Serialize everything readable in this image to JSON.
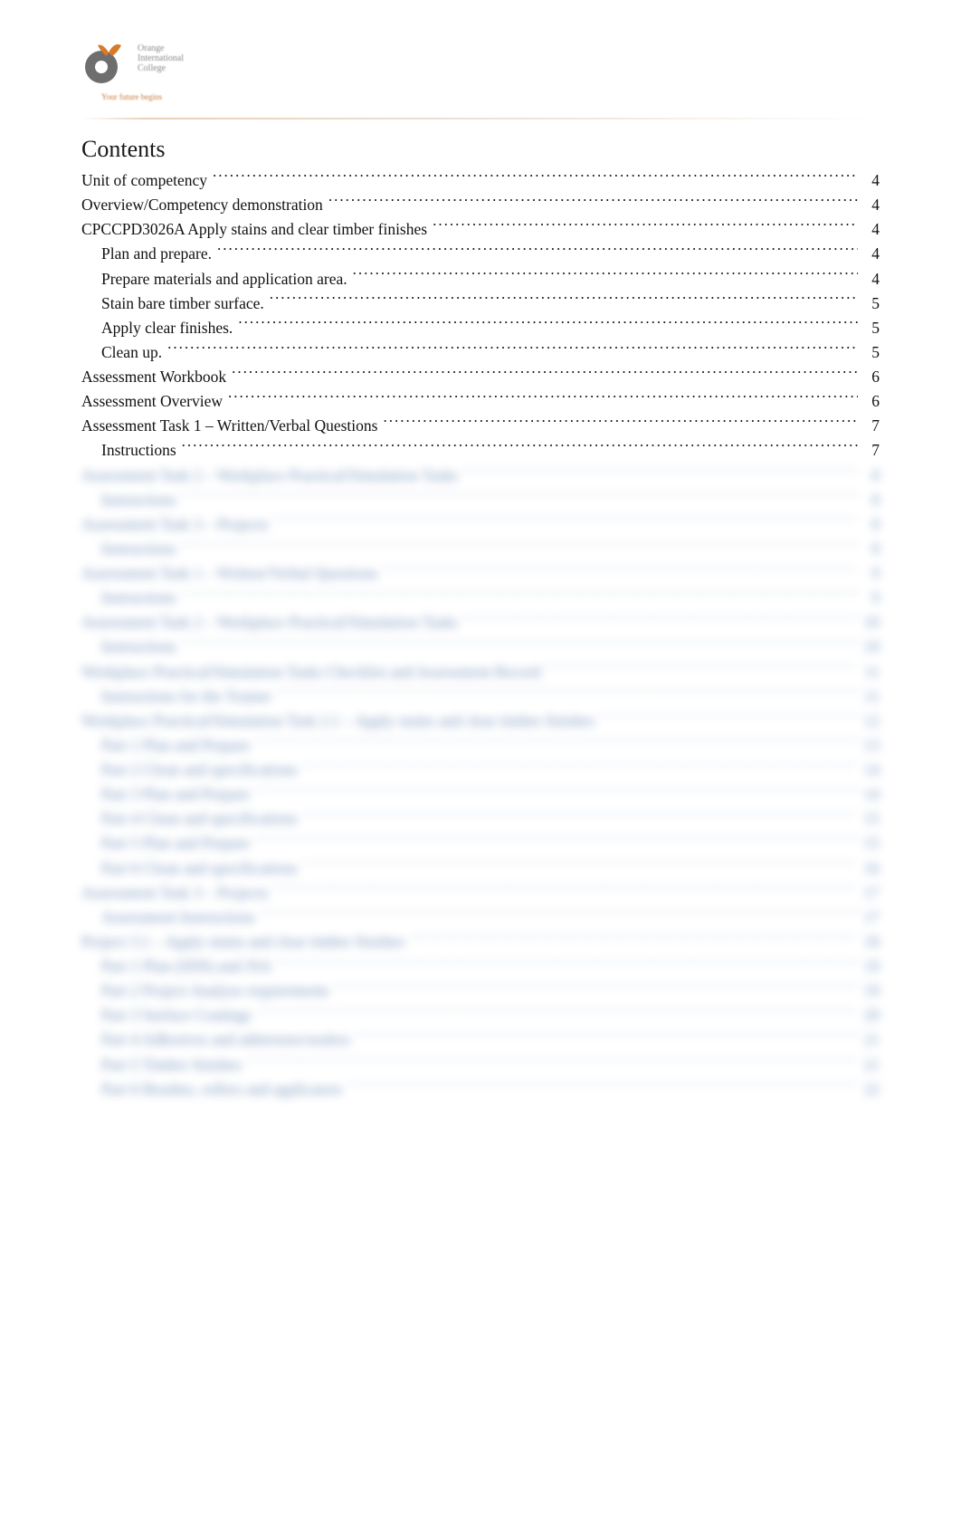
{
  "logo": {
    "line1": "Orange",
    "line2": "International",
    "line3": "College",
    "tag": "Your future begins"
  },
  "title": "Contents",
  "toc": [
    {
      "label": "Unit of competency",
      "page": "4",
      "indent": 0
    },
    {
      "label": "Overview/Competency demonstration",
      "page": "4",
      "indent": 0
    },
    {
      "label": "CPCCPD3026A Apply stains and clear timber finishes",
      "page": "4",
      "indent": 0
    },
    {
      "label": "Plan and prepare.",
      "page": "4",
      "indent": 1
    },
    {
      "label": "Prepare materials and application area.",
      "page": "4",
      "indent": 1
    },
    {
      "label": "Stain bare timber surface.",
      "page": "5",
      "indent": 1
    },
    {
      "label": "Apply clear finishes.",
      "page": "5",
      "indent": 1
    },
    {
      "label": "Clean up.",
      "page": "5",
      "indent": 1
    },
    {
      "label": "Assessment Workbook",
      "page": "6",
      "indent": 0
    },
    {
      "label": "Assessment Overview",
      "page": "6",
      "indent": 0
    },
    {
      "label": "Assessment Task 1 – Written/Verbal Questions",
      "page": "7",
      "indent": 0
    },
    {
      "label": "Instructions",
      "page": "7",
      "indent": 1
    }
  ],
  "blurred": [
    {
      "label": "Assessment Task 2 – Workplace Practical/Simulation Tasks",
      "page": "8",
      "indent": 0
    },
    {
      "label": "Instructions",
      "page": "8",
      "indent": 1
    },
    {
      "label": "Assessment Task 3 – Projects",
      "page": "8",
      "indent": 0
    },
    {
      "label": "Instructions",
      "page": "8",
      "indent": 1
    },
    {
      "label": "Assessment Task 1 – Written/Verbal Questions",
      "page": "9",
      "indent": 0
    },
    {
      "label": "Instructions",
      "page": "9",
      "indent": 1
    },
    {
      "label": "Assessment Task 2 – Workplace Practical/Simulation Tasks",
      "page": "10",
      "indent": 0
    },
    {
      "label": "Instructions",
      "page": "10",
      "indent": 1
    },
    {
      "label": "Workplace Practical/Simulation Tasks Checklist and Assessment Record",
      "page": "11",
      "indent": 0
    },
    {
      "label": "Instructions for the Trainer",
      "page": "11",
      "indent": 1
    },
    {
      "label": "Workplace Practical/Simulation Task 2.1 – Apply stains and clear timber finishes",
      "page": "12",
      "indent": 0
    },
    {
      "label": "Part 1 Plan and Prepare",
      "page": "13",
      "indent": 1
    },
    {
      "label": "Part 2 Clean and specifications",
      "page": "14",
      "indent": 1
    },
    {
      "label": "Part 3 Plan and Prepare",
      "page": "14",
      "indent": 1
    },
    {
      "label": "Part 4 Clean and specifications",
      "page": "15",
      "indent": 1
    },
    {
      "label": "Part 5 Plan and Prepare",
      "page": "15",
      "indent": 1
    },
    {
      "label": "Part 6 Clean and specifications",
      "page": "16",
      "indent": 1
    },
    {
      "label": "Assessment Task 3 – Projects",
      "page": "17",
      "indent": 0
    },
    {
      "label": "Assessment Instructions",
      "page": "17",
      "indent": 1
    },
    {
      "label": "Project 3.1 – Apply stains and clear timber finishes",
      "page": "18",
      "indent": 0
    },
    {
      "label": "Part 1 Plan (SDS) and JSA",
      "page": "19",
      "indent": 1
    },
    {
      "label": "Part 2 Project Analyse requirements",
      "page": "19",
      "indent": 1
    },
    {
      "label": "Part 3 Surface Coatings",
      "page": "20",
      "indent": 1
    },
    {
      "label": "Part 4 Adhesives and admixture/sealers",
      "page": "21",
      "indent": 1
    },
    {
      "label": "Part 5 Timber finishes",
      "page": "21",
      "indent": 1
    },
    {
      "label": "Part 6 Brushes, rollers and applicators",
      "page": "22",
      "indent": 1
    }
  ]
}
